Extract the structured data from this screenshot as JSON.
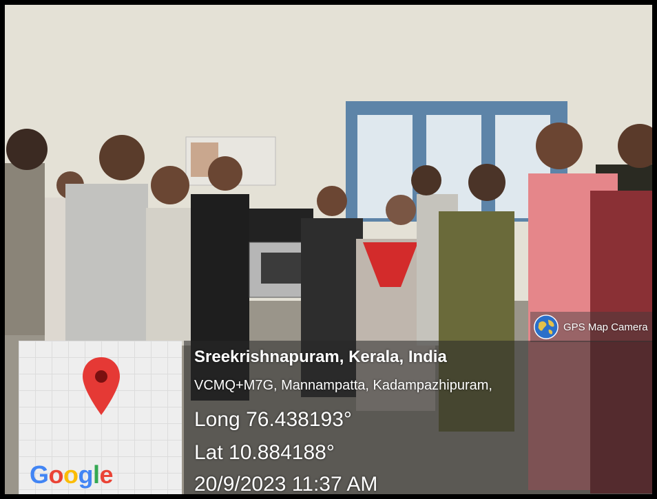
{
  "overlay": {
    "badge_label": "GPS Map Camera",
    "badge_icon": "globe-icon",
    "location_title": "Sreekrishnapuram, Kerala, India",
    "address": "VCMQ+M7G, Mannampatta, Kadampazhipuram,",
    "longitude": "Long 76.438193°",
    "latitude": "Lat 10.884188°",
    "datetime": "20/9/2023 11:37 AM"
  },
  "map": {
    "pin_icon": "map-pin-icon",
    "pin_color": "#E53935",
    "logo": "Google"
  },
  "colors": {
    "frame": "#000000",
    "panel_text": "#FFFFFF"
  }
}
